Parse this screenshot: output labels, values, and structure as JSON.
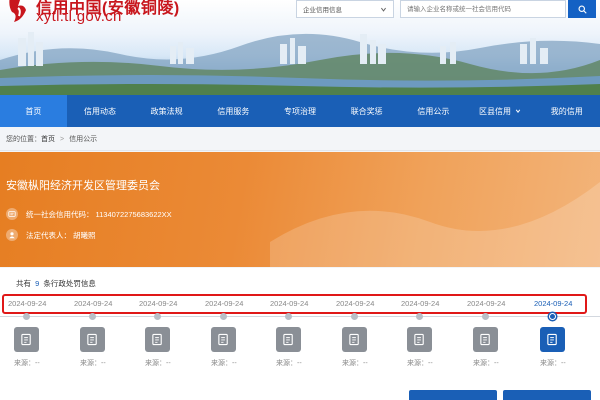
{
  "site": {
    "title": "信用中国(安徽铜陵)",
    "url": "xytl.tl.gov.cn"
  },
  "search": {
    "category": "企业信用信息",
    "placeholder": "请输入企业名称或统一社会信用代码"
  },
  "nav": {
    "items": [
      {
        "label": "首页",
        "active": true
      },
      {
        "label": "信用动态"
      },
      {
        "label": "政策法规"
      },
      {
        "label": "信用服务"
      },
      {
        "label": "专项治理"
      },
      {
        "label": "联合奖惩"
      },
      {
        "label": "信用公示"
      },
      {
        "label": "区县信用",
        "dropdown": true
      },
      {
        "label": "我的信用"
      }
    ]
  },
  "breadcrumb": {
    "prefix": "您的位置：",
    "home": "首页",
    "separator": ">",
    "current": "信用公示"
  },
  "org": {
    "name": "安徽枞阳经济开发区管理委员会",
    "credit_code_label": "统一社会信用代码：",
    "credit_code": "113407227568362​2XX",
    "rep_label": "法定代表人：",
    "rep": "胡曦照"
  },
  "records": {
    "prefix": "共有",
    "count": "9",
    "suffix": "条行政处罚信息",
    "items": [
      {
        "date": "2024-09-24",
        "source": "来源：--"
      },
      {
        "date": "2024-09-24",
        "source": "来源：--"
      },
      {
        "date": "2024-09-24",
        "source": "来源：--"
      },
      {
        "date": "2024-09-24",
        "source": "来源：--"
      },
      {
        "date": "2024-09-24",
        "source": "来源：--"
      },
      {
        "date": "2024-09-24",
        "source": "来源：--"
      },
      {
        "date": "2024-09-24",
        "source": "来源：--"
      },
      {
        "date": "2024-09-24",
        "source": "来源：--"
      },
      {
        "date": "2024-09-24",
        "source": "来源：--",
        "active": true
      }
    ]
  },
  "buttons": {
    "left": "",
    "right": ""
  },
  "colors": {
    "brand_red": "#c8161d",
    "nav_blue": "#1a5fb6",
    "nav_active": "#2a7de0",
    "org_orange": "#e67e22",
    "highlight_red": "#e01818"
  }
}
